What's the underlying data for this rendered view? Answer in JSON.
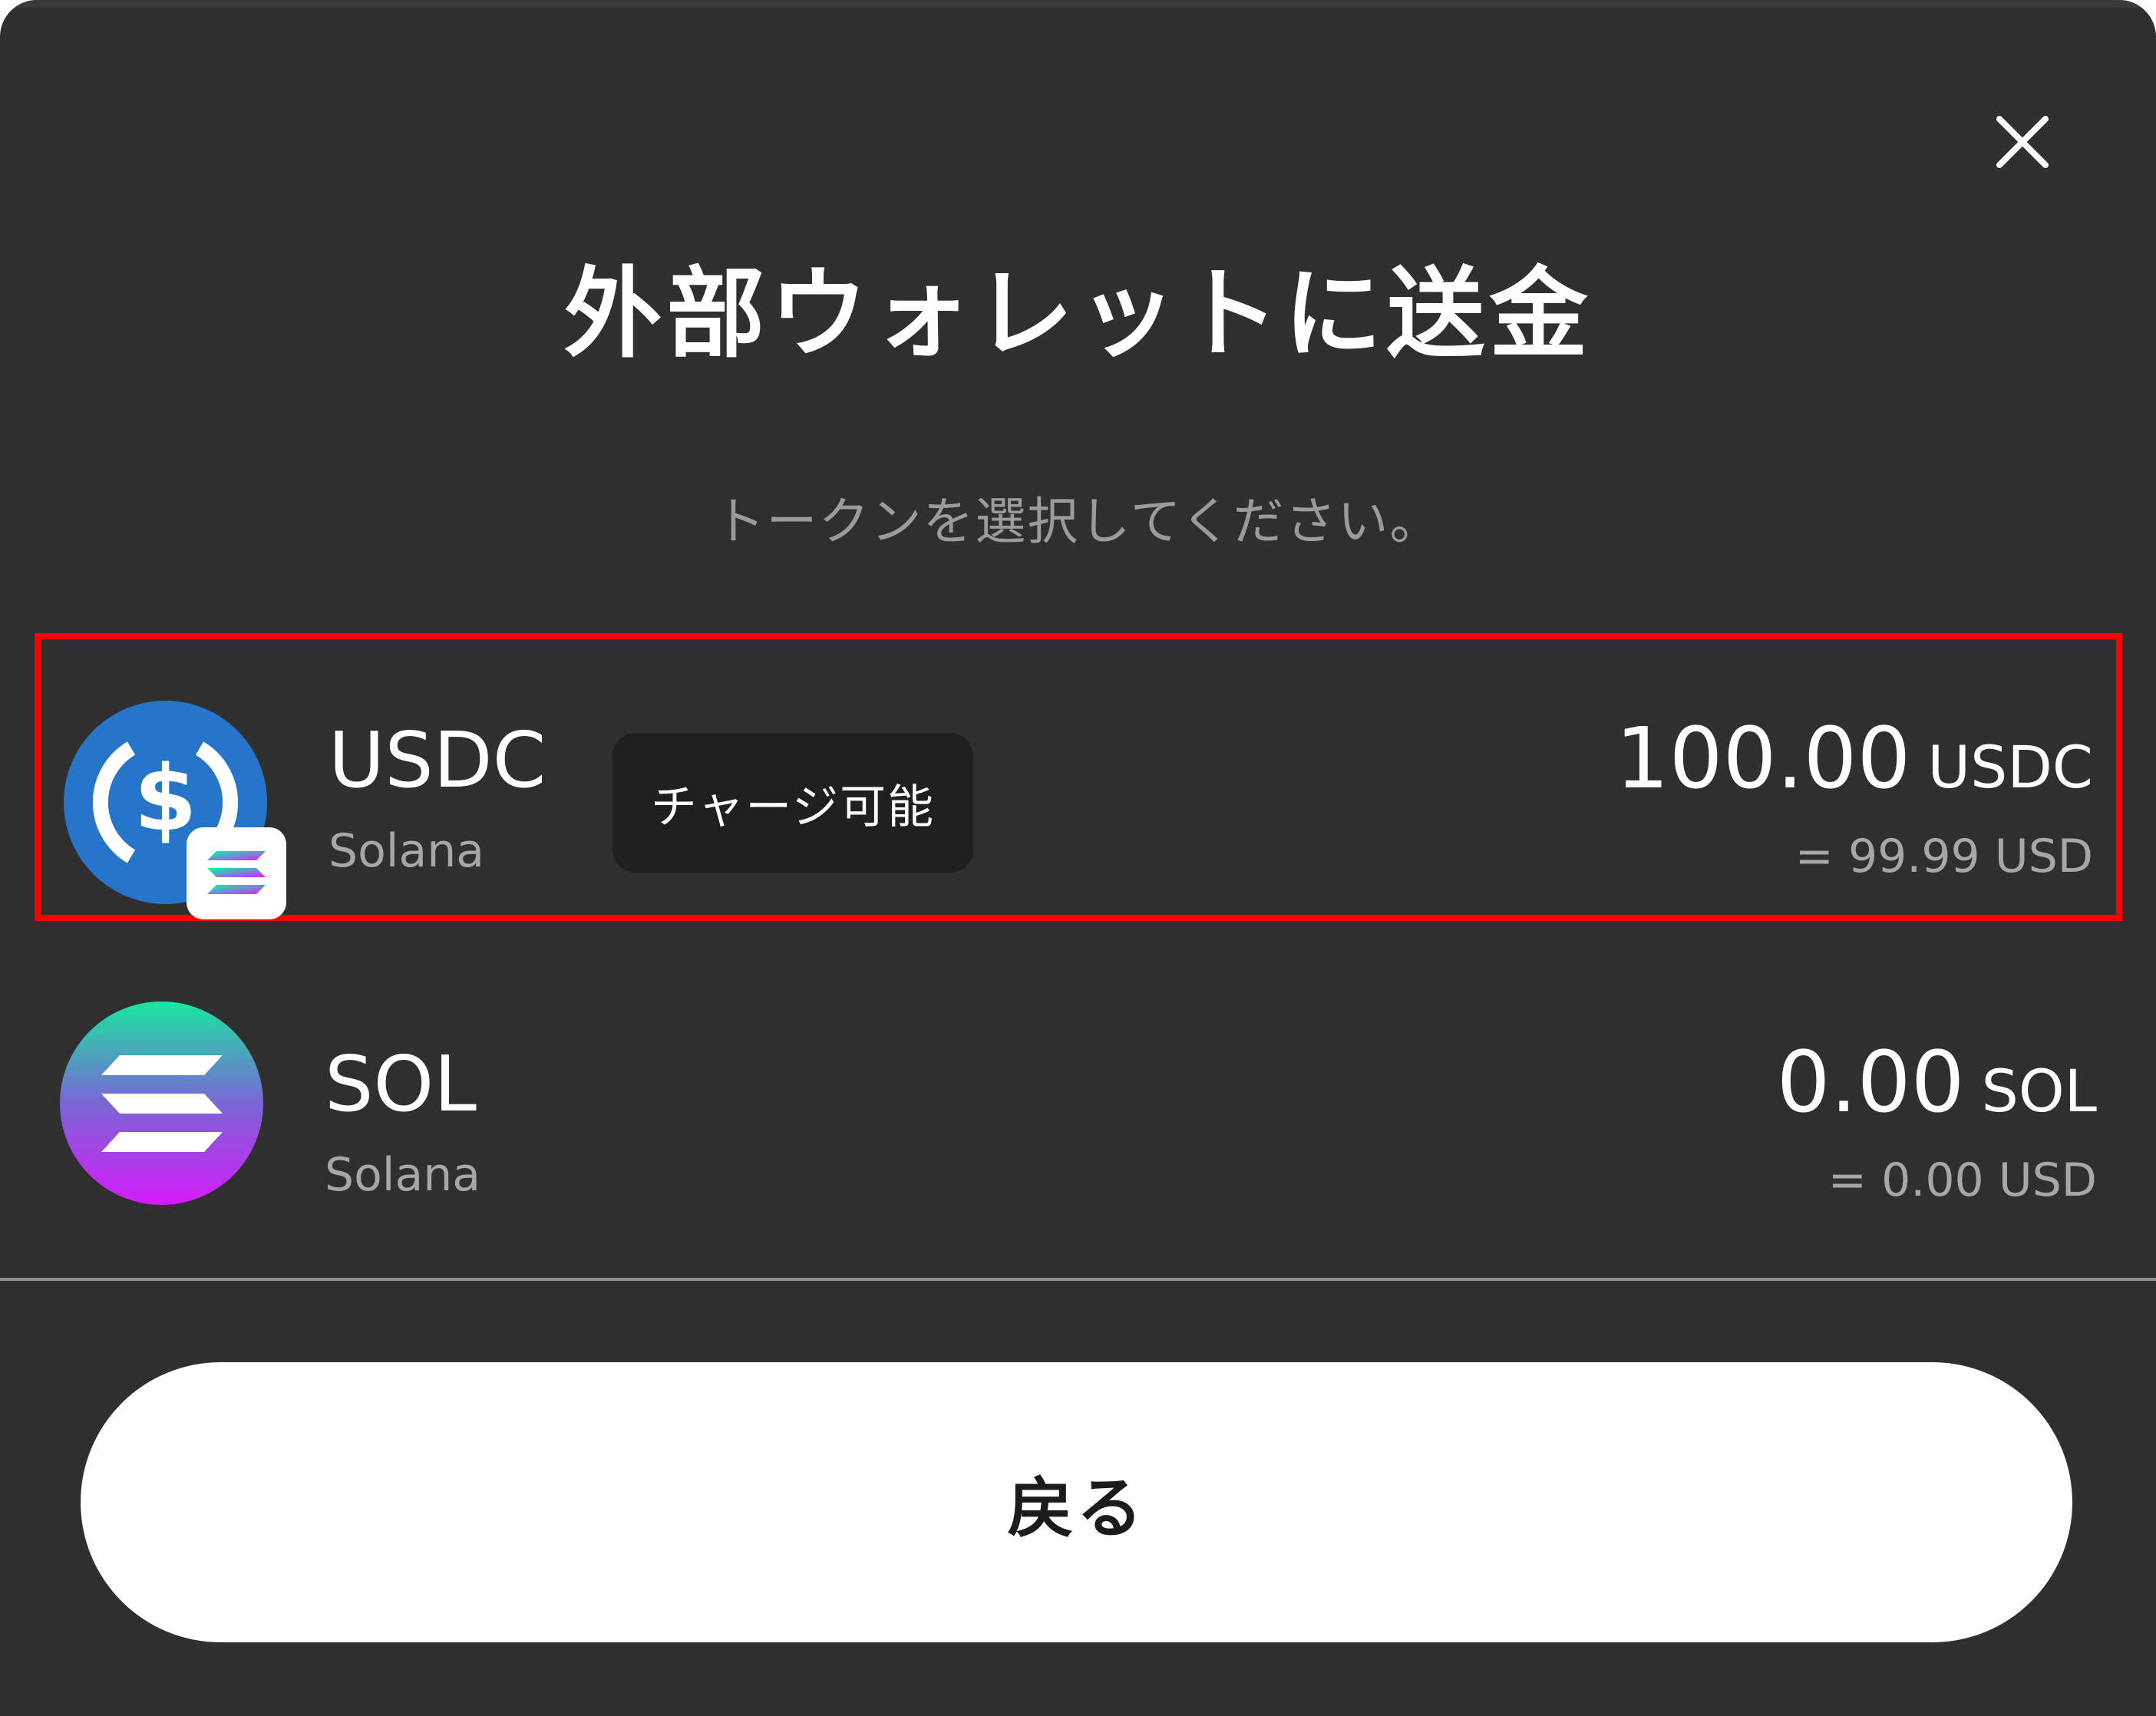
{
  "header": {
    "title": "外部ウォレットに送金",
    "subtitle": "トークンを選択してください。"
  },
  "tokens": [
    {
      "symbol": "USDC",
      "chain": "Solana",
      "badge": "チャージ可能",
      "amount": "100.00",
      "unit": "USDC",
      "fiat": "= 99.99 USD",
      "icon": "usdc-icon",
      "highlighted": true
    },
    {
      "symbol": "SOL",
      "chain": "Solana",
      "amount": "0.00",
      "unit": "SOL",
      "fiat": "= 0.00 USD",
      "icon": "sol-icon",
      "highlighted": false
    }
  ],
  "footer": {
    "back_label": "戻る"
  },
  "colors": {
    "background": "#2f2f30",
    "highlight_border": "#ff0000",
    "usdc_blue": "#2775ca",
    "button_bg": "#ffffff",
    "muted_text": "#a7a7a8"
  }
}
